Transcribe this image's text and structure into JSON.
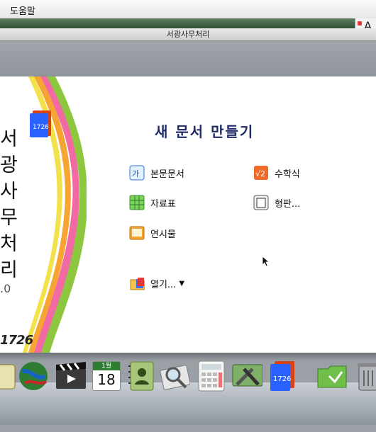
{
  "menubar": {
    "items": [
      "",
      "도움말"
    ]
  },
  "window": {
    "title": "서광사무처리"
  },
  "splash": {
    "vertical_text": [
      "서",
      "광",
      "사",
      "무",
      "처",
      "리"
    ],
    "version": ".0",
    "brand": "1726"
  },
  "newdoc": {
    "title": "새 문서 만들기",
    "items": [
      {
        "label": "본문문서",
        "icon": "document-ga-icon"
      },
      {
        "label": "수학식",
        "icon": "math-root-icon"
      },
      {
        "label": "자료표",
        "icon": "spreadsheet-icon"
      },
      {
        "label": "형판...",
        "icon": "template-icon"
      },
      {
        "label": "연시물",
        "icon": "presentation-icon"
      }
    ],
    "open_label": "열기...",
    "open_arrow": "▼"
  },
  "topright": {
    "label": "A"
  },
  "dock": {
    "calendar": {
      "month": "1월",
      "day": "18"
    }
  }
}
